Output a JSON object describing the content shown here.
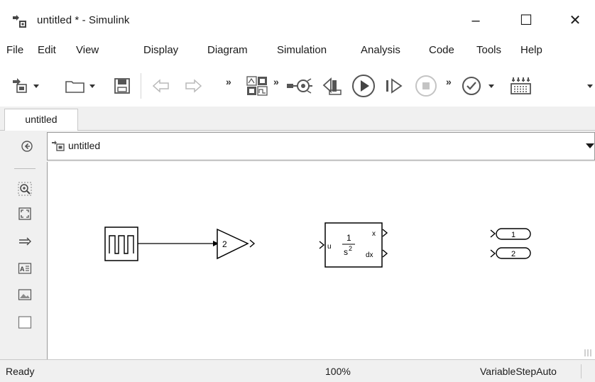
{
  "window": {
    "title": "untitled * - Simulink",
    "controls": {
      "minimize": "–",
      "maximize": "☐",
      "close": "✕"
    }
  },
  "menu": [
    "File",
    "Edit",
    "View",
    "Display",
    "Diagram",
    "Simulation",
    "Analysis",
    "Code",
    "Tools",
    "Help"
  ],
  "toolbar": {
    "buttons": [
      "new-model-icon",
      "open-icon",
      "save-icon",
      "back-arrow-icon",
      "forward-arrow-icon",
      "library-browser-icon",
      "model-configuration-icon",
      "step-back-icon",
      "run-icon",
      "step-forward-icon",
      "stop-icon",
      "model-advisor-icon",
      "build-icon"
    ],
    "overflow": "»"
  },
  "tabs": [
    {
      "label": "untitled"
    }
  ],
  "address": {
    "breadcrumb": "untitled"
  },
  "palette": [
    "nav-back-icon",
    "zoom-icon",
    "fit-to-view-icon",
    "arrow-connector-icon",
    "text-annotation-icon",
    "image-icon",
    "area-icon"
  ],
  "diagram": {
    "blocks": {
      "pulse": {
        "kind": "Pulse Generator",
        "icon": "pulse-wave-icon"
      },
      "gain": {
        "kind": "Gain",
        "label": "2"
      },
      "integrator": {
        "kind": "Second-Order Integrator",
        "input_port": "u",
        "numerator": "1",
        "denominator": "s",
        "denominator_exp": "2",
        "out1": "x",
        "out2": "dx"
      },
      "outport1": {
        "label": "1"
      },
      "outport2": {
        "label": "2"
      }
    }
  },
  "status": {
    "state": "Ready",
    "zoom": "100%",
    "solver": "VariableStepAuto"
  },
  "colors": {
    "chrome": "#f0f0f0",
    "canvas": "#ffffff",
    "line": "#000000"
  }
}
